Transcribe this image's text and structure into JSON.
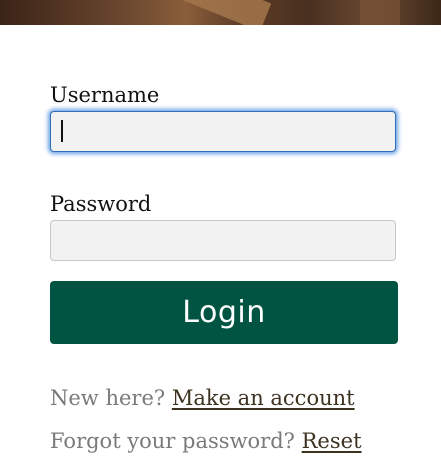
{
  "form": {
    "username_label": "Username",
    "username_value": "",
    "password_label": "Password",
    "password_value": "",
    "login_label": "Login"
  },
  "footer": {
    "new_here_text": "New here?",
    "make_account_link": "Make an account",
    "forgot_text": "Forgot your password?",
    "reset_link": "Reset"
  },
  "colors": {
    "login_button": "#015442",
    "focus_ring": "#3b82dc",
    "input_background": "#f2f2f2"
  }
}
